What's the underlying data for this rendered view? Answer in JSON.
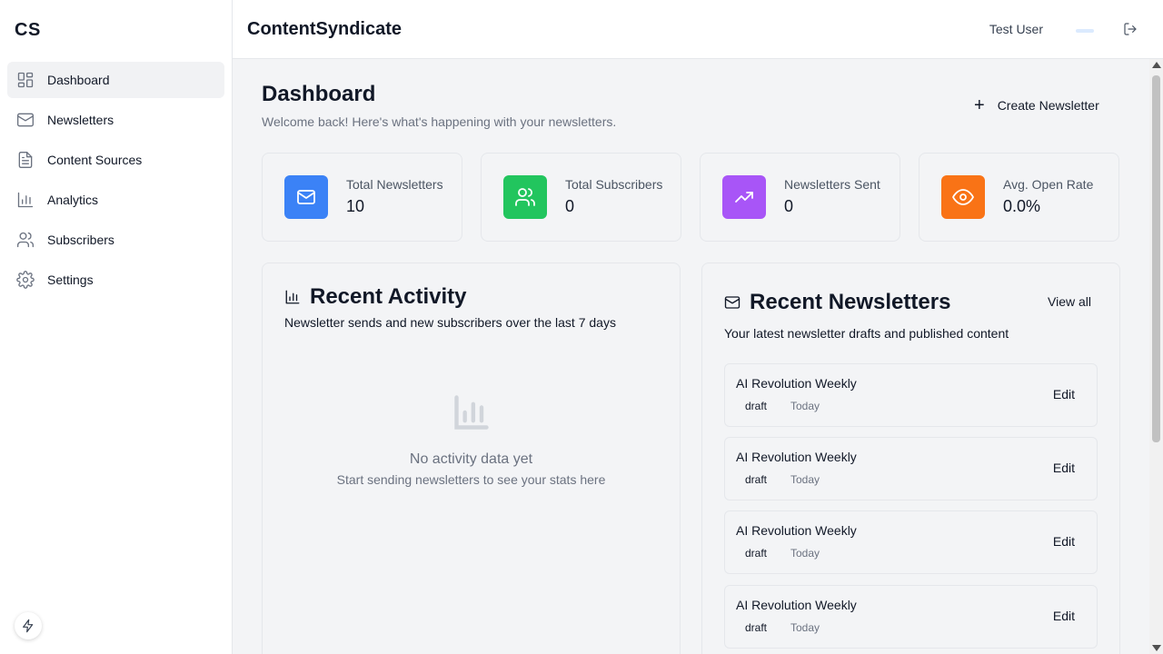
{
  "sidebar": {
    "brand": "CS",
    "items": [
      {
        "label": "Dashboard",
        "icon": "dashboard-icon",
        "active": true
      },
      {
        "label": "Newsletters",
        "icon": "mail-icon"
      },
      {
        "label": "Content Sources",
        "icon": "document-icon"
      },
      {
        "label": "Analytics",
        "icon": "bar-chart-icon"
      },
      {
        "label": "Subscribers",
        "icon": "users-icon"
      },
      {
        "label": "Settings",
        "icon": "gear-icon"
      }
    ],
    "floating_icon": "bolt-icon"
  },
  "header": {
    "title": "ContentSyndicate",
    "user_name": "Test User",
    "logout_icon": "logout-icon"
  },
  "main": {
    "title": "Dashboard",
    "subtitle": "Welcome back! Here's what's happening with your newsletters.",
    "create_button": "Create Newsletter",
    "stats": [
      {
        "label": "Total Newsletters",
        "value": "10",
        "icon": "mail-icon",
        "color": "#3b82f6"
      },
      {
        "label": "Total Subscribers",
        "value": "0",
        "icon": "users-icon",
        "color": "#22c55e"
      },
      {
        "label": "Newsletters Sent",
        "value": "0",
        "icon": "trending-up-icon",
        "color": "#a855f7"
      },
      {
        "label": "Avg. Open Rate",
        "value": "0.0%",
        "icon": "eye-icon",
        "color": "#f97316"
      }
    ],
    "activity": {
      "title": "Recent Activity",
      "subtitle": "Newsletter sends and new subscribers over the last 7 days",
      "empty_title": "No activity data yet",
      "empty_subtitle": "Start sending newsletters to see your stats here"
    },
    "recent": {
      "title": "Recent Newsletters",
      "subtitle": "Your latest newsletter drafts and published content",
      "view_all": "View all",
      "items": [
        {
          "title": "AI Revolution Weekly",
          "status": "draft",
          "date": "Today",
          "action": "Edit"
        },
        {
          "title": "AI Revolution Weekly",
          "status": "draft",
          "date": "Today",
          "action": "Edit"
        },
        {
          "title": "AI Revolution Weekly",
          "status": "draft",
          "date": "Today",
          "action": "Edit"
        },
        {
          "title": "AI Revolution Weekly",
          "status": "draft",
          "date": "Today",
          "action": "Edit"
        }
      ]
    }
  }
}
